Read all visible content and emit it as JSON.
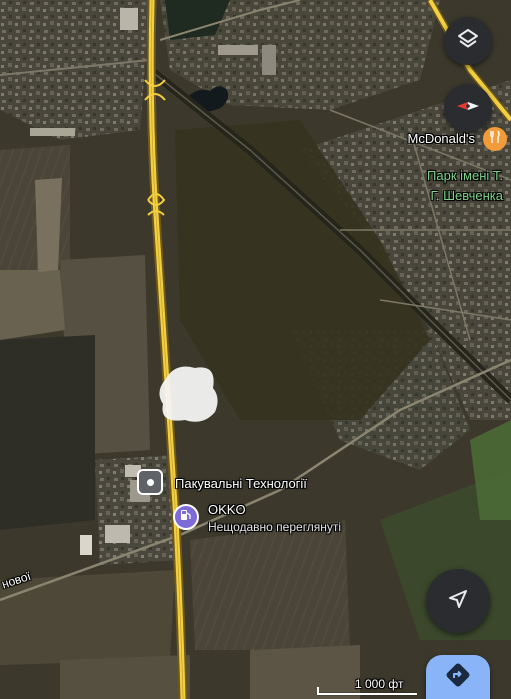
{
  "map": {
    "pois": {
      "mcdonalds": "McDonald's",
      "park_line1": "Парк імені Т.",
      "park_line2": "Г. Шевченка",
      "pakuvalni": "Пакувальні Технології",
      "okko": "OKKO",
      "okko_subtitle": "Нещодавно переглянуті"
    },
    "road_label_fragment": "нової",
    "scale_label": "1 000 фт"
  },
  "controls": {
    "layers": "layers-icon",
    "compass": "compass-icon",
    "my_location": "navigation-arrow-icon",
    "directions": "directions-icon"
  },
  "colors": {
    "fab_bg": "#2b2c2f",
    "restaurant_pin": "#f29b38",
    "fuel_pin": "#7d6bd8",
    "park_label": "#7fd38c",
    "directions_bg": "#8ab4f8",
    "compass_red": "#e53935"
  }
}
